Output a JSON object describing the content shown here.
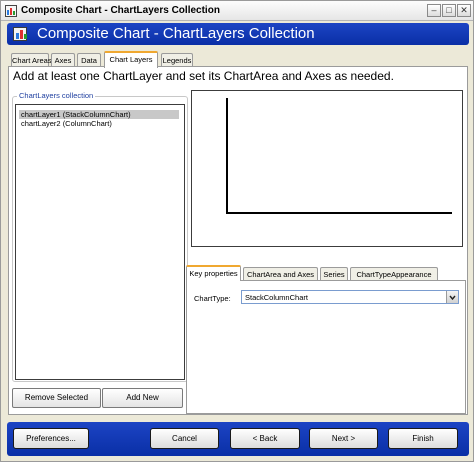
{
  "window": {
    "title": "Composite Chart - ChartLayers Collection",
    "controls": [
      "minimize",
      "maximize",
      "close"
    ]
  },
  "header": {
    "title": "Composite Chart - ChartLayers Collection"
  },
  "tabs": [
    {
      "label": "Chart Areas"
    },
    {
      "label": "Axes"
    },
    {
      "label": "Data"
    },
    {
      "label": "Chart Layers",
      "active": true
    },
    {
      "label": "Legends"
    }
  ],
  "instruction": "Add at least one ChartLayer and set its ChartArea and Axes as needed.",
  "collection": {
    "legend": "ChartLayers collection",
    "items": [
      {
        "label": "chartLayer1 (StackColumnChart)",
        "selected": true
      },
      {
        "label": "chartLayer2 (ColumnChart)"
      }
    ],
    "remove_label": "Remove Selected",
    "add_label": "Add New"
  },
  "sub_tabs": [
    {
      "label": "Key properties",
      "active": true
    },
    {
      "label": "ChartArea and Axes"
    },
    {
      "label": "Series"
    },
    {
      "label": "ChartTypeAppearance"
    }
  ],
  "properties": {
    "charttype_label": "ChartType:",
    "charttype_value": "StackColumnChart"
  },
  "footer": {
    "preferences": "Preferences...",
    "cancel": "Cancel",
    "back": "< Back",
    "next": "Next >",
    "finish": "Finish"
  },
  "colors": {
    "header_blue": "#1c44c4",
    "tab_accent": "#f0a830"
  }
}
